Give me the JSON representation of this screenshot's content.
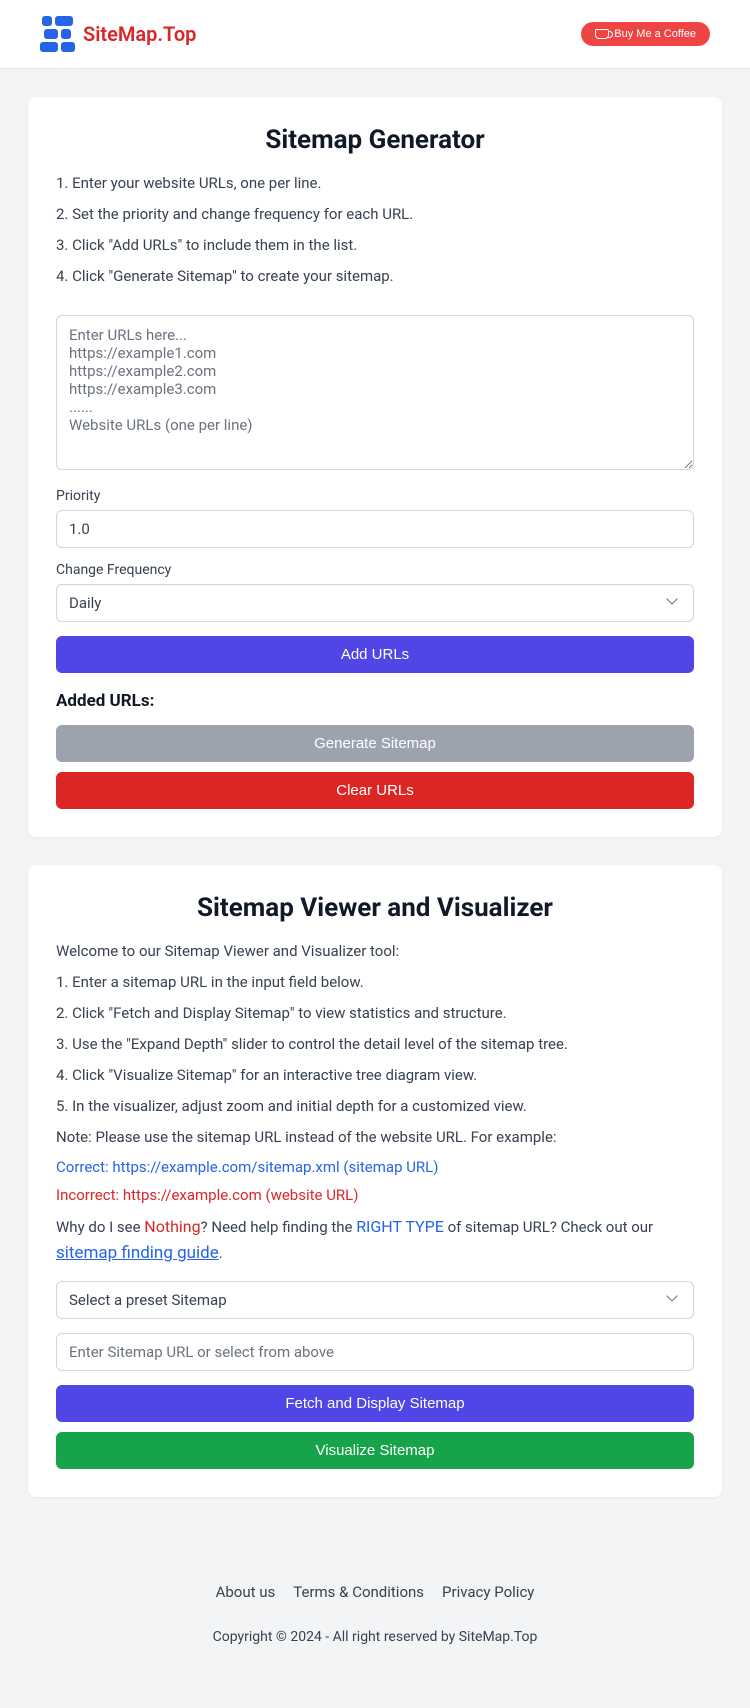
{
  "header": {
    "logo_text": "SiteMap.Top",
    "coffee_label": "Buy Me a Coffee"
  },
  "generator": {
    "title": "Sitemap Generator",
    "instructions": [
      "1. Enter your website URLs, one per line.",
      "2. Set the priority and change frequency for each URL.",
      "3. Click \"Add URLs\" to include them in the list.",
      "4. Click \"Generate Sitemap\" to create your sitemap."
    ],
    "url_placeholder": "Enter URLs here...\nhttps://example1.com\nhttps://example2.com\nhttps://example3.com\n......\nWebsite URLs (one per line)",
    "priority_label": "Priority",
    "priority_value": "1.0",
    "freq_label": "Change Frequency",
    "freq_value": "Daily",
    "add_btn": "Add URLs",
    "added_heading": "Added URLs:",
    "generate_btn": "Generate Sitemap",
    "clear_btn": "Clear URLs"
  },
  "viewer": {
    "title": "Sitemap Viewer and Visualizer",
    "intro": "Welcome to our Sitemap Viewer and Visualizer tool:",
    "instructions": [
      "1. Enter a sitemap URL in the input field below.",
      "2. Click \"Fetch and Display Sitemap\" to view statistics and structure.",
      "3. Use the \"Expand Depth\" slider to control the detail level of the sitemap tree.",
      "4. Click \"Visualize Sitemap\" for an interactive tree diagram view.",
      "5. In the visualizer, adjust zoom and initial depth for a customized view."
    ],
    "note": "Note: Please use the sitemap URL instead of the website URL. For example:",
    "correct": "Correct: https://example.com/sitemap.xml (sitemap URL)",
    "incorrect": "Incorrect: https://example.com (website URL)",
    "help_pre": "Why do I see ",
    "help_nothing": "Nothing",
    "help_mid": "? Need help finding the ",
    "help_right": "RIGHT TYPE",
    "help_post": " of sitemap URL? Check out our ",
    "help_link": "sitemap finding guide",
    "help_end": ".",
    "preset_value": "Select a preset Sitemap",
    "url_placeholder": "Enter Sitemap URL or select from above",
    "fetch_btn": "Fetch and Display Sitemap",
    "visualize_btn": "Visualize Sitemap"
  },
  "footer": {
    "links": [
      "About us",
      "Terms & Conditions",
      "Privacy Policy"
    ],
    "copyright": "Copyright © 2024 - All right reserved by SiteMap.Top"
  }
}
